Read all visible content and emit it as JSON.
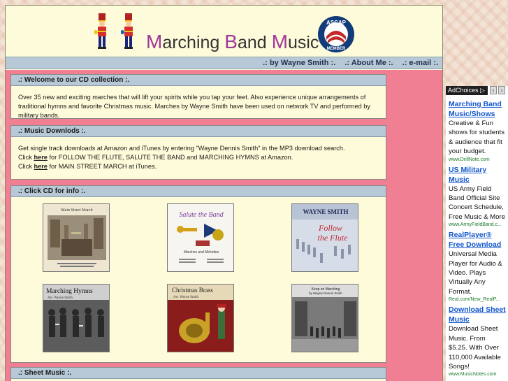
{
  "header": {
    "title_parts": [
      {
        "cap": "M",
        "rest": "arching "
      },
      {
        "cap": "B",
        "rest": "and "
      },
      {
        "cap": "M",
        "rest": "usic"
      }
    ],
    "badge_top": "ASCAP",
    "badge_bottom": "MEMBER"
  },
  "nav": {
    "byline": ".: by Wayne Smith :.",
    "about": ".: About Me :.",
    "email": ".: e-mail :."
  },
  "welcome": {
    "title": ".: Welcome to our CD collection :.",
    "text": "Over 35 new and exciting marches that will lift your spirits while you tap your feet. Also experience unique arrangements of traditional hymns and favorite Christmas music. Marches by Wayne Smith have been used on network TV and performed by military bands."
  },
  "downloads": {
    "title": ".: Music Downlods :.",
    "line1": "Get single track downloads at Amazon and iTunes by entering \"Wayne Dennis Smith\" in the MP3 download search.",
    "line2_pre": "Click ",
    "line2_link": "here",
    "line2_post": " for FOLLOW THE FLUTE, SALUTE THE BAND and MARCHING HYMNS at Amazon.",
    "line3_pre": "Click ",
    "line3_link": "here",
    "line3_post": " for MAIN STREET MARCH at iTunes."
  },
  "cds": {
    "title": ".: Click CD for info :.",
    "items": [
      {
        "title": "Main Street March"
      },
      {
        "title": "Salute the Band",
        "subtitle": "Marches and Melodies"
      },
      {
        "title": "WAYNE SMITH",
        "subtitle1": "Follow",
        "subtitle2": "the Flute"
      },
      {
        "title": "Marching Hymns",
        "subtitle": "Arr. Wayne Smith"
      },
      {
        "title": "Christmas Brass",
        "subtitle": "Arr. Wayne Smith"
      },
      {
        "title": "Keep on Marching",
        "subtitle": "by Wayne Dennis Smith"
      }
    ]
  },
  "sheet_music": {
    "title": ".: Sheet Music :."
  },
  "ads": {
    "choices_label": "AdChoices ▷",
    "items": [
      {
        "title": "Marching Band Music/Shows",
        "text": "Creative & Fun shows for students & audience that fit your budget.",
        "url": "www.DrillNote.com"
      },
      {
        "title": "US Military Music",
        "text": "US Army Field Band Official Site Concert Schedule, Free Music & More",
        "url": "www.ArmyFieldBand.c..."
      },
      {
        "title": "RealPlayer® Free Download",
        "text": "Universal Media Player for Audio & Video. Plays Virtually Any Format.",
        "url": "Real.com/New_RealP..."
      },
      {
        "title": "Download Sheet Music",
        "text": "Download Sheet Music. From $5.25. With Over 110,000 Available Songs!",
        "url": "www.MusicNotes.com"
      }
    ]
  },
  "colors": {
    "page_bg": "#fdfbd9",
    "panel_header": "#b7c9d6",
    "content_bg": "#f07f93",
    "title_accent": "#a03a9a",
    "ad_link": "#1155cc"
  }
}
